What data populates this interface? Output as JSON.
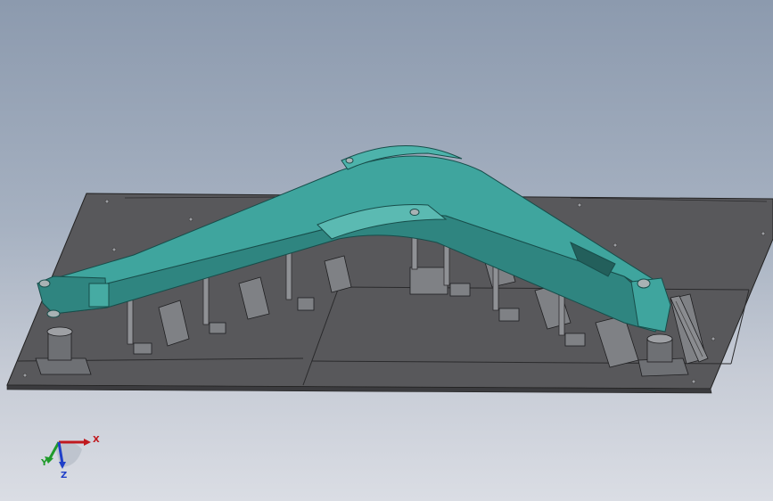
{
  "viewport": {
    "background_top": "#8c9aae",
    "background_bottom": "#dadde4"
  },
  "model": {
    "part_color": "#3a9a94",
    "plate_color": "#5d5d60",
    "fixture_color": "#7d7f83"
  },
  "triad": {
    "x_label": "X",
    "y_label": "Y",
    "z_label": "Z",
    "x_color": "#c0191e",
    "y_color": "#1f9a2a",
    "z_color": "#1f3fc8"
  }
}
